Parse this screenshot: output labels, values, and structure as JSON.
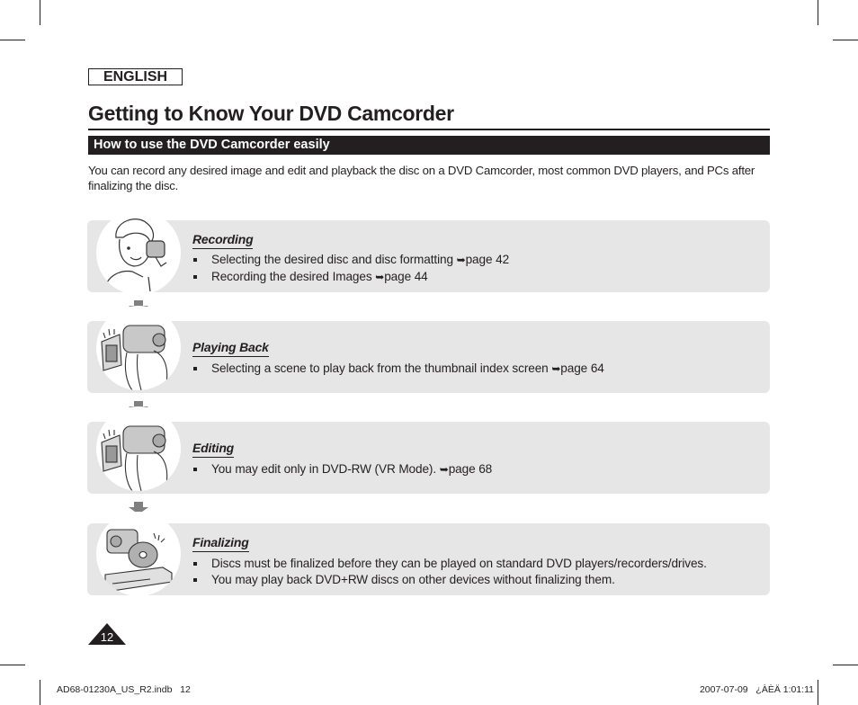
{
  "language_label": "ENGLISH",
  "page_title": "Getting to Know Your DVD Camcorder",
  "section_title": "How to use the DVD Camcorder easily",
  "intro_text": "You can record any desired image and edit and playback the disc on a DVD Camcorder, most common DVD players, and PCs after finalizing the disc.",
  "page_ref_arrow": "➥",
  "steps": [
    {
      "heading": "Recording",
      "illustration": "person-with-camcorder",
      "bullets": [
        {
          "text": "Selecting the desired disc and disc formatting ",
          "ref": "page 42"
        },
        {
          "text": "Recording the desired Images ",
          "ref": "page 44"
        }
      ]
    },
    {
      "heading": "Playing Back",
      "illustration": "hands-holding-camcorder-lcd",
      "bullets": [
        {
          "text": "Selecting a scene to play back from the thumbnail index screen ",
          "ref": "page 64"
        }
      ]
    },
    {
      "heading": "Editing",
      "illustration": "hands-holding-camcorder-lcd",
      "bullets": [
        {
          "text": "You may edit only in DVD-RW (VR Mode). ",
          "ref": "page 68"
        }
      ]
    },
    {
      "heading": "Finalizing",
      "illustration": "camcorder-disc-dvd-player",
      "bullets": [
        {
          "text": "Discs must be finalized before they can be played on standard DVD players/recorders/drives.",
          "ref": ""
        },
        {
          "text": "You may play back DVD+RW discs on other devices without finalizing them.",
          "ref": ""
        }
      ]
    }
  ],
  "page_number": "12",
  "footer": {
    "file_info": "AD68-01230A_US_R2.indb   12",
    "timestamp": "2007-07-09   ¿ÀÈÄ 1:01:11"
  },
  "colors": {
    "text": "#231f20",
    "card_background": "#e6e6e6",
    "flow_arrow": "#808080",
    "section_bar": "#231f20"
  }
}
